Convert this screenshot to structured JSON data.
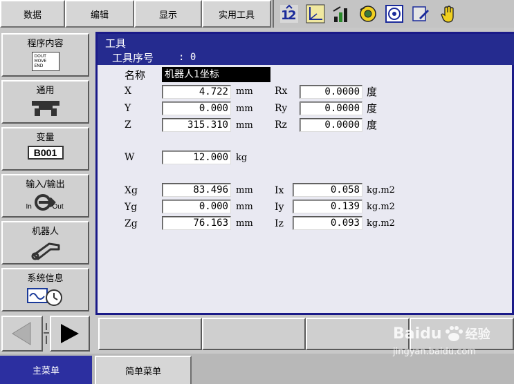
{
  "menu": {
    "data_label": "数据",
    "edit_label": "编辑",
    "display_label": "显示",
    "utility_label": "实用工具"
  },
  "toolbar_icons": [
    "coordinate-toggle-icon",
    "axes-icon",
    "signal-bars-icon",
    "gear-cycle-icon",
    "target-icon",
    "edit-pen-icon",
    "hand-icon"
  ],
  "sidebar": {
    "items": [
      {
        "label": "程序内容",
        "icon_lines": [
          "DOUT",
          "MOVE",
          "END"
        ]
      },
      {
        "label": "通用",
        "icon": "tool-clamp-icon"
      },
      {
        "label": "变量",
        "badge": "B001"
      },
      {
        "label": "输入/输出",
        "io_in": "In",
        "io_out": "Out"
      },
      {
        "label": "机器人",
        "icon": "robot-arm-icon"
      },
      {
        "label": "系统信息",
        "icon": "wave-clock-icon"
      }
    ]
  },
  "panel": {
    "title": "工具",
    "tool_no_label": "工具序号",
    "tool_no_value": ": 0",
    "name_label": "名称",
    "name_value": "机器人1坐标"
  },
  "position": {
    "x": {
      "label": "X",
      "value": "4.722",
      "unit": "mm"
    },
    "y": {
      "label": "Y",
      "value": "0.000",
      "unit": "mm"
    },
    "z": {
      "label": "Z",
      "value": "315.310",
      "unit": "mm"
    },
    "rx": {
      "label": "Rx",
      "value": "0.0000",
      "unit": "度"
    },
    "ry": {
      "label": "Ry",
      "value": "0.0000",
      "unit": "度"
    },
    "rz": {
      "label": "Rz",
      "value": "0.0000",
      "unit": "度"
    }
  },
  "weight": {
    "label": "W",
    "value": "12.000",
    "unit": "kg"
  },
  "center_of_gravity": {
    "xg": {
      "label": "Xg",
      "value": "83.496",
      "unit": "mm"
    },
    "yg": {
      "label": "Yg",
      "value": "0.000",
      "unit": "mm"
    },
    "zg": {
      "label": "Zg",
      "value": "76.163",
      "unit": "mm"
    }
  },
  "inertia": {
    "ix": {
      "label": "Ix",
      "value": "0.058",
      "unit": "kg.m2"
    },
    "iy": {
      "label": "Iy",
      "value": "0.139",
      "unit": "kg.m2"
    },
    "iz": {
      "label": "Iz",
      "value": "0.093",
      "unit": "kg.m2"
    }
  },
  "bottom_tabs": {
    "main_menu": "主菜单",
    "simple_menu": "简单菜单"
  },
  "watermark": {
    "brand": "Baidu",
    "brand_cn": "经验",
    "url": "jingyan.baidu.com"
  },
  "colors": {
    "title_bar": "#252b8f",
    "panel_bg": "#e9e9f2",
    "main_tab": "#2c2fa0"
  }
}
